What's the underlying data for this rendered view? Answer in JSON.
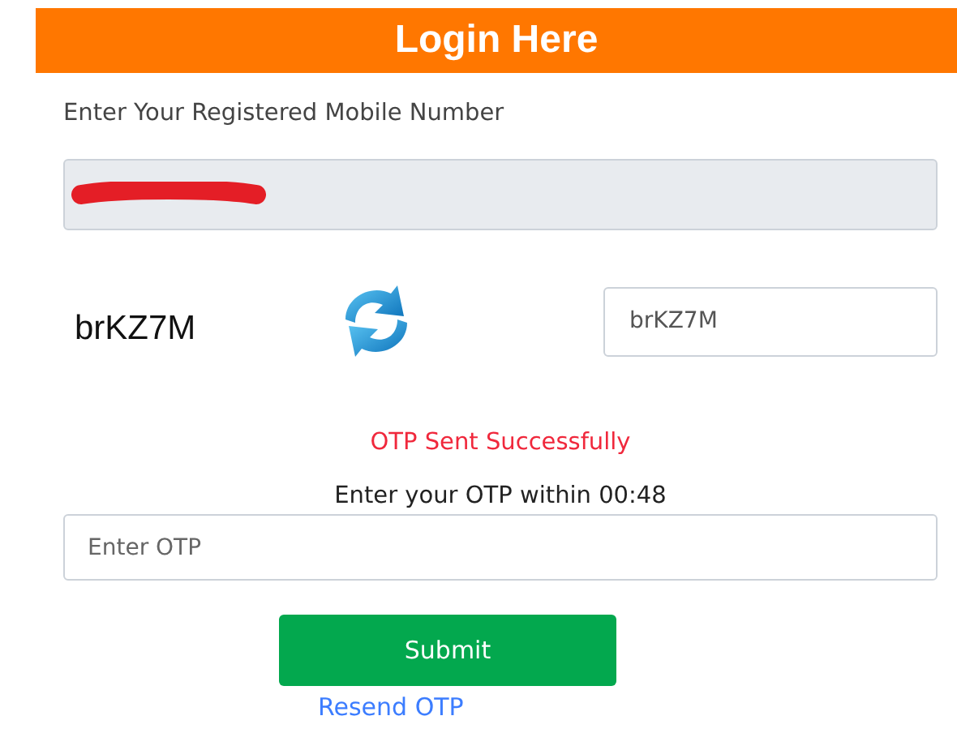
{
  "header": {
    "title": "Login Here"
  },
  "mobile": {
    "label": "Enter Your Registered Mobile Number",
    "disabled": true,
    "redacted": true
  },
  "captcha": {
    "code": "brKZ7M",
    "input_value": "brKZ7M"
  },
  "status": {
    "message": "OTP Sent Successfully",
    "kind": "success"
  },
  "otp": {
    "timer_text": "Enter your OTP within 00:48",
    "placeholder": "Enter OTP"
  },
  "buttons": {
    "submit": "Submit",
    "resend": "Resend OTP"
  }
}
